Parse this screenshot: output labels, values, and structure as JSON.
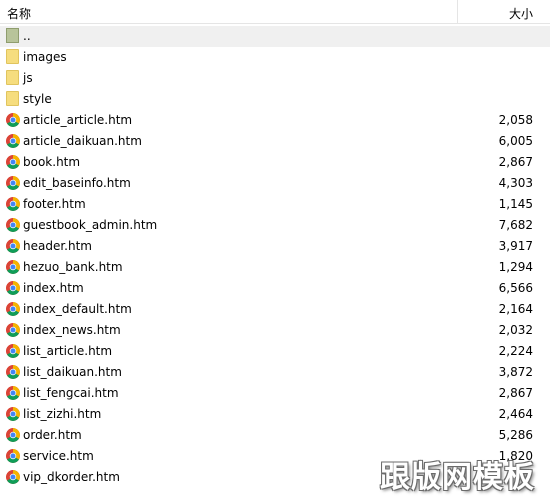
{
  "columns": {
    "name": "名称",
    "size": "大小"
  },
  "files": [
    {
      "name": "..",
      "size": "",
      "icon": "parent-folder-icon",
      "selected": true
    },
    {
      "name": "images",
      "size": "",
      "icon": "folder-icon"
    },
    {
      "name": "js",
      "size": "",
      "icon": "folder-icon"
    },
    {
      "name": "style",
      "size": "",
      "icon": "folder-icon"
    },
    {
      "name": "article_article.htm",
      "size": "2,058",
      "icon": "chrome-html-file-icon"
    },
    {
      "name": "article_daikuan.htm",
      "size": "6,005",
      "icon": "chrome-html-file-icon"
    },
    {
      "name": "book.htm",
      "size": "2,867",
      "icon": "chrome-html-file-icon"
    },
    {
      "name": "edit_baseinfo.htm",
      "size": "4,303",
      "icon": "chrome-html-file-icon"
    },
    {
      "name": "footer.htm",
      "size": "1,145",
      "icon": "chrome-html-file-icon"
    },
    {
      "name": "guestbook_admin.htm",
      "size": "7,682",
      "icon": "chrome-html-file-icon"
    },
    {
      "name": "header.htm",
      "size": "3,917",
      "icon": "chrome-html-file-icon"
    },
    {
      "name": "hezuo_bank.htm",
      "size": "1,294",
      "icon": "chrome-html-file-icon"
    },
    {
      "name": "index.htm",
      "size": "6,566",
      "icon": "chrome-html-file-icon"
    },
    {
      "name": "index_default.htm",
      "size": "2,164",
      "icon": "chrome-html-file-icon"
    },
    {
      "name": "index_news.htm",
      "size": "2,032",
      "icon": "chrome-html-file-icon"
    },
    {
      "name": "list_article.htm",
      "size": "2,224",
      "icon": "chrome-html-file-icon"
    },
    {
      "name": "list_daikuan.htm",
      "size": "3,872",
      "icon": "chrome-html-file-icon"
    },
    {
      "name": "list_fengcai.htm",
      "size": "2,867",
      "icon": "chrome-html-file-icon"
    },
    {
      "name": "list_zizhi.htm",
      "size": "2,464",
      "icon": "chrome-html-file-icon"
    },
    {
      "name": "order.htm",
      "size": "5,286",
      "icon": "chrome-html-file-icon"
    },
    {
      "name": "service.htm",
      "size": "1,820",
      "icon": "chrome-html-file-icon"
    },
    {
      "name": "vip_dkorder.htm",
      "size": "",
      "icon": "chrome-html-file-icon"
    }
  ],
  "watermark": "跟版网模板",
  "colors": {
    "folder": "#f6dd7e",
    "selected_row": "#f0f0f0",
    "header_border": "#e5e5e5"
  }
}
